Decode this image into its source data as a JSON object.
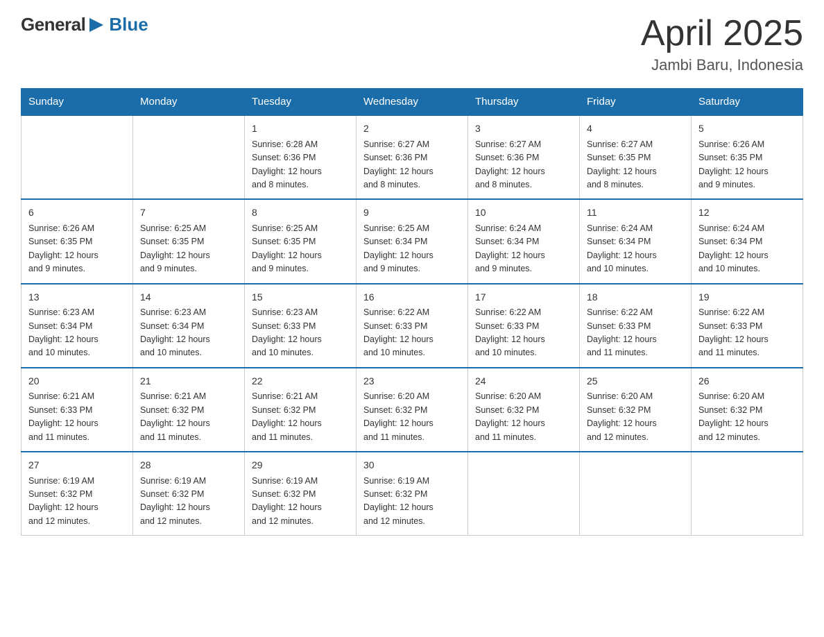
{
  "header": {
    "logo_general": "General",
    "logo_blue": "Blue",
    "title": "April 2025",
    "subtitle": "Jambi Baru, Indonesia"
  },
  "days_of_week": [
    "Sunday",
    "Monday",
    "Tuesday",
    "Wednesday",
    "Thursday",
    "Friday",
    "Saturday"
  ],
  "weeks": [
    [
      {
        "day": "",
        "info": ""
      },
      {
        "day": "",
        "info": ""
      },
      {
        "day": "1",
        "info": "Sunrise: 6:28 AM\nSunset: 6:36 PM\nDaylight: 12 hours\nand 8 minutes."
      },
      {
        "day": "2",
        "info": "Sunrise: 6:27 AM\nSunset: 6:36 PM\nDaylight: 12 hours\nand 8 minutes."
      },
      {
        "day": "3",
        "info": "Sunrise: 6:27 AM\nSunset: 6:36 PM\nDaylight: 12 hours\nand 8 minutes."
      },
      {
        "day": "4",
        "info": "Sunrise: 6:27 AM\nSunset: 6:35 PM\nDaylight: 12 hours\nand 8 minutes."
      },
      {
        "day": "5",
        "info": "Sunrise: 6:26 AM\nSunset: 6:35 PM\nDaylight: 12 hours\nand 9 minutes."
      }
    ],
    [
      {
        "day": "6",
        "info": "Sunrise: 6:26 AM\nSunset: 6:35 PM\nDaylight: 12 hours\nand 9 minutes."
      },
      {
        "day": "7",
        "info": "Sunrise: 6:25 AM\nSunset: 6:35 PM\nDaylight: 12 hours\nand 9 minutes."
      },
      {
        "day": "8",
        "info": "Sunrise: 6:25 AM\nSunset: 6:35 PM\nDaylight: 12 hours\nand 9 minutes."
      },
      {
        "day": "9",
        "info": "Sunrise: 6:25 AM\nSunset: 6:34 PM\nDaylight: 12 hours\nand 9 minutes."
      },
      {
        "day": "10",
        "info": "Sunrise: 6:24 AM\nSunset: 6:34 PM\nDaylight: 12 hours\nand 9 minutes."
      },
      {
        "day": "11",
        "info": "Sunrise: 6:24 AM\nSunset: 6:34 PM\nDaylight: 12 hours\nand 10 minutes."
      },
      {
        "day": "12",
        "info": "Sunrise: 6:24 AM\nSunset: 6:34 PM\nDaylight: 12 hours\nand 10 minutes."
      }
    ],
    [
      {
        "day": "13",
        "info": "Sunrise: 6:23 AM\nSunset: 6:34 PM\nDaylight: 12 hours\nand 10 minutes."
      },
      {
        "day": "14",
        "info": "Sunrise: 6:23 AM\nSunset: 6:34 PM\nDaylight: 12 hours\nand 10 minutes."
      },
      {
        "day": "15",
        "info": "Sunrise: 6:23 AM\nSunset: 6:33 PM\nDaylight: 12 hours\nand 10 minutes."
      },
      {
        "day": "16",
        "info": "Sunrise: 6:22 AM\nSunset: 6:33 PM\nDaylight: 12 hours\nand 10 minutes."
      },
      {
        "day": "17",
        "info": "Sunrise: 6:22 AM\nSunset: 6:33 PM\nDaylight: 12 hours\nand 10 minutes."
      },
      {
        "day": "18",
        "info": "Sunrise: 6:22 AM\nSunset: 6:33 PM\nDaylight: 12 hours\nand 11 minutes."
      },
      {
        "day": "19",
        "info": "Sunrise: 6:22 AM\nSunset: 6:33 PM\nDaylight: 12 hours\nand 11 minutes."
      }
    ],
    [
      {
        "day": "20",
        "info": "Sunrise: 6:21 AM\nSunset: 6:33 PM\nDaylight: 12 hours\nand 11 minutes."
      },
      {
        "day": "21",
        "info": "Sunrise: 6:21 AM\nSunset: 6:32 PM\nDaylight: 12 hours\nand 11 minutes."
      },
      {
        "day": "22",
        "info": "Sunrise: 6:21 AM\nSunset: 6:32 PM\nDaylight: 12 hours\nand 11 minutes."
      },
      {
        "day": "23",
        "info": "Sunrise: 6:20 AM\nSunset: 6:32 PM\nDaylight: 12 hours\nand 11 minutes."
      },
      {
        "day": "24",
        "info": "Sunrise: 6:20 AM\nSunset: 6:32 PM\nDaylight: 12 hours\nand 11 minutes."
      },
      {
        "day": "25",
        "info": "Sunrise: 6:20 AM\nSunset: 6:32 PM\nDaylight: 12 hours\nand 12 minutes."
      },
      {
        "day": "26",
        "info": "Sunrise: 6:20 AM\nSunset: 6:32 PM\nDaylight: 12 hours\nand 12 minutes."
      }
    ],
    [
      {
        "day": "27",
        "info": "Sunrise: 6:19 AM\nSunset: 6:32 PM\nDaylight: 12 hours\nand 12 minutes."
      },
      {
        "day": "28",
        "info": "Sunrise: 6:19 AM\nSunset: 6:32 PM\nDaylight: 12 hours\nand 12 minutes."
      },
      {
        "day": "29",
        "info": "Sunrise: 6:19 AM\nSunset: 6:32 PM\nDaylight: 12 hours\nand 12 minutes."
      },
      {
        "day": "30",
        "info": "Sunrise: 6:19 AM\nSunset: 6:32 PM\nDaylight: 12 hours\nand 12 minutes."
      },
      {
        "day": "",
        "info": ""
      },
      {
        "day": "",
        "info": ""
      },
      {
        "day": "",
        "info": ""
      }
    ]
  ]
}
